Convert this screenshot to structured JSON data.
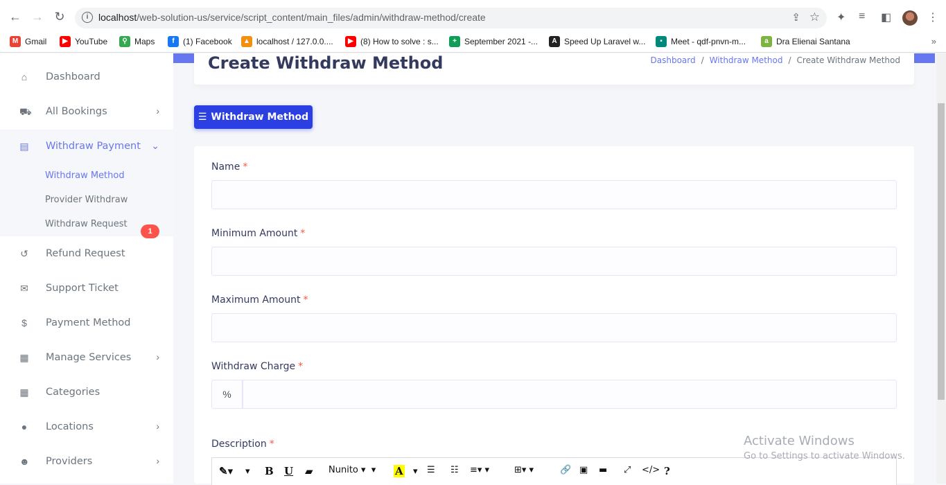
{
  "browser": {
    "url_host": "localhost",
    "url_path": "/web-solution-us/service/script_content/main_files/admin/withdraw-method/create",
    "bookmarks": [
      {
        "label": "Gmail",
        "icon": "gmail-icon",
        "color": "#ea4335",
        "glyph": "M"
      },
      {
        "label": "YouTube",
        "icon": "youtube-icon",
        "color": "#ff0000",
        "glyph": "▶"
      },
      {
        "label": "Maps",
        "icon": "maps-icon",
        "color": "#34a853",
        "glyph": "⚲"
      },
      {
        "label": "(1) Facebook",
        "icon": "facebook-icon",
        "color": "#1877f2",
        "glyph": "f"
      },
      {
        "label": "localhost / 127.0.0....",
        "icon": "phpmyadmin-icon",
        "color": "#f29111",
        "glyph": "▲"
      },
      {
        "label": "(8) How to solve : s...",
        "icon": "youtube-icon",
        "color": "#ff0000",
        "glyph": "▶"
      },
      {
        "label": "September 2021 -...",
        "icon": "sheets-icon",
        "color": "#0f9d58",
        "glyph": "+"
      },
      {
        "label": "Speed Up Laravel w...",
        "icon": "laravel-icon",
        "color": "#222222",
        "glyph": "A"
      },
      {
        "label": "Meet - qdf-pnvn-m...",
        "icon": "meet-icon",
        "color": "#00897b",
        "glyph": "▪"
      },
      {
        "label": "Dra Elienai Santana",
        "icon": "site-icon",
        "color": "#7cb342",
        "glyph": "a"
      }
    ]
  },
  "sidebar": {
    "items": [
      {
        "label": "Dashboard",
        "icon": "home-icon",
        "glyph": "⌂"
      },
      {
        "label": "All Bookings",
        "icon": "cart-icon",
        "glyph": "🛒",
        "arrow": "›"
      },
      {
        "label": "Withdraw Payment",
        "icon": "wallet-icon",
        "glyph": "▤",
        "arrow": "⌄"
      },
      {
        "label": "Refund Request",
        "icon": "undo-icon",
        "glyph": "↺"
      },
      {
        "label": "Support Ticket",
        "icon": "envelope-icon",
        "glyph": "✉"
      },
      {
        "label": "Payment Method",
        "icon": "dollar-icon",
        "glyph": "$"
      },
      {
        "label": "Manage Services",
        "icon": "grid-icon",
        "glyph": "▦",
        "arrow": "›"
      },
      {
        "label": "Categories",
        "icon": "grid-icon",
        "glyph": "▦"
      },
      {
        "label": "Locations",
        "icon": "map-pin-icon",
        "glyph": "●",
        "arrow": "›"
      },
      {
        "label": "Providers",
        "icon": "users-icon",
        "glyph": "👥",
        "arrow": "›"
      }
    ],
    "subitems": [
      "Withdraw Method",
      "Provider Withdraw",
      "Withdraw Request"
    ],
    "support_badge": "1"
  },
  "header": {
    "title": "Create Withdraw Method",
    "breadcrumbs": [
      "Dashboard",
      "Withdraw Method",
      "Create Withdraw Method"
    ]
  },
  "toolbar": {
    "withdraw_method_label": "Withdraw Method"
  },
  "form": {
    "name_label": "Name",
    "min_label": "Minimum Amount",
    "max_label": "Maximum Amount",
    "charge_label": "Withdraw Charge",
    "charge_prepend": "%",
    "desc_label": "Description",
    "required_mark": "*"
  },
  "editor": {
    "font_name": "Nunito"
  },
  "watermark": {
    "line1": "Activate Windows",
    "line2": "Go to Settings to activate Windows."
  },
  "colors": {
    "accent": "#6777ef",
    "primary_button": "#2b3fe3",
    "badge": "#fc544b"
  }
}
